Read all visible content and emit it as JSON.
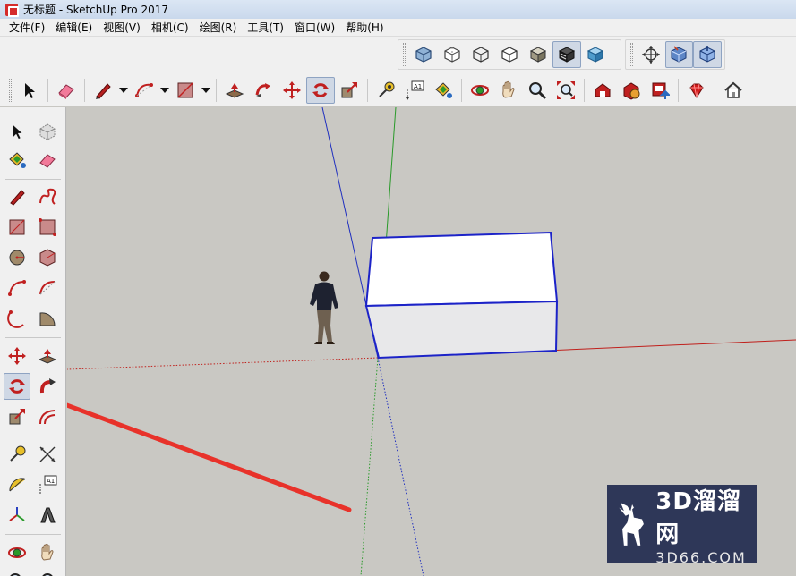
{
  "window": {
    "title": "无标题 - SketchUp Pro 2017"
  },
  "menu": [
    "文件(F)",
    "编辑(E)",
    "视图(V)",
    "相机(C)",
    "绘图(R)",
    "工具(T)",
    "窗口(W)",
    "帮助(H)"
  ],
  "styles_toolbar": [
    "xray-style-icon",
    "back-edges-style-icon",
    "wireframe-style-icon",
    "hidden-line-style-icon",
    "shaded-style-icon",
    "shaded-textures-style-icon",
    "monochrome-style-icon"
  ],
  "views_toolbar": [
    "orbit-icon",
    "iso-view-icon",
    "top-view-icon"
  ],
  "main_toolbar": {
    "label_tool_text": "A1"
  },
  "left_toolbar": {
    "label_tool_text": "A1",
    "active_tool": "rotate"
  },
  "watermark": {
    "brand": "3D溜溜网",
    "url": "3D66.COM"
  },
  "colors": {
    "axis_red": "#c0201c",
    "axis_green": "#2a9a2a",
    "axis_blue": "#1f2fbf",
    "box_edge": "#1c23c8",
    "arrow": "#e8322a",
    "watermark_bg": "#142046"
  }
}
